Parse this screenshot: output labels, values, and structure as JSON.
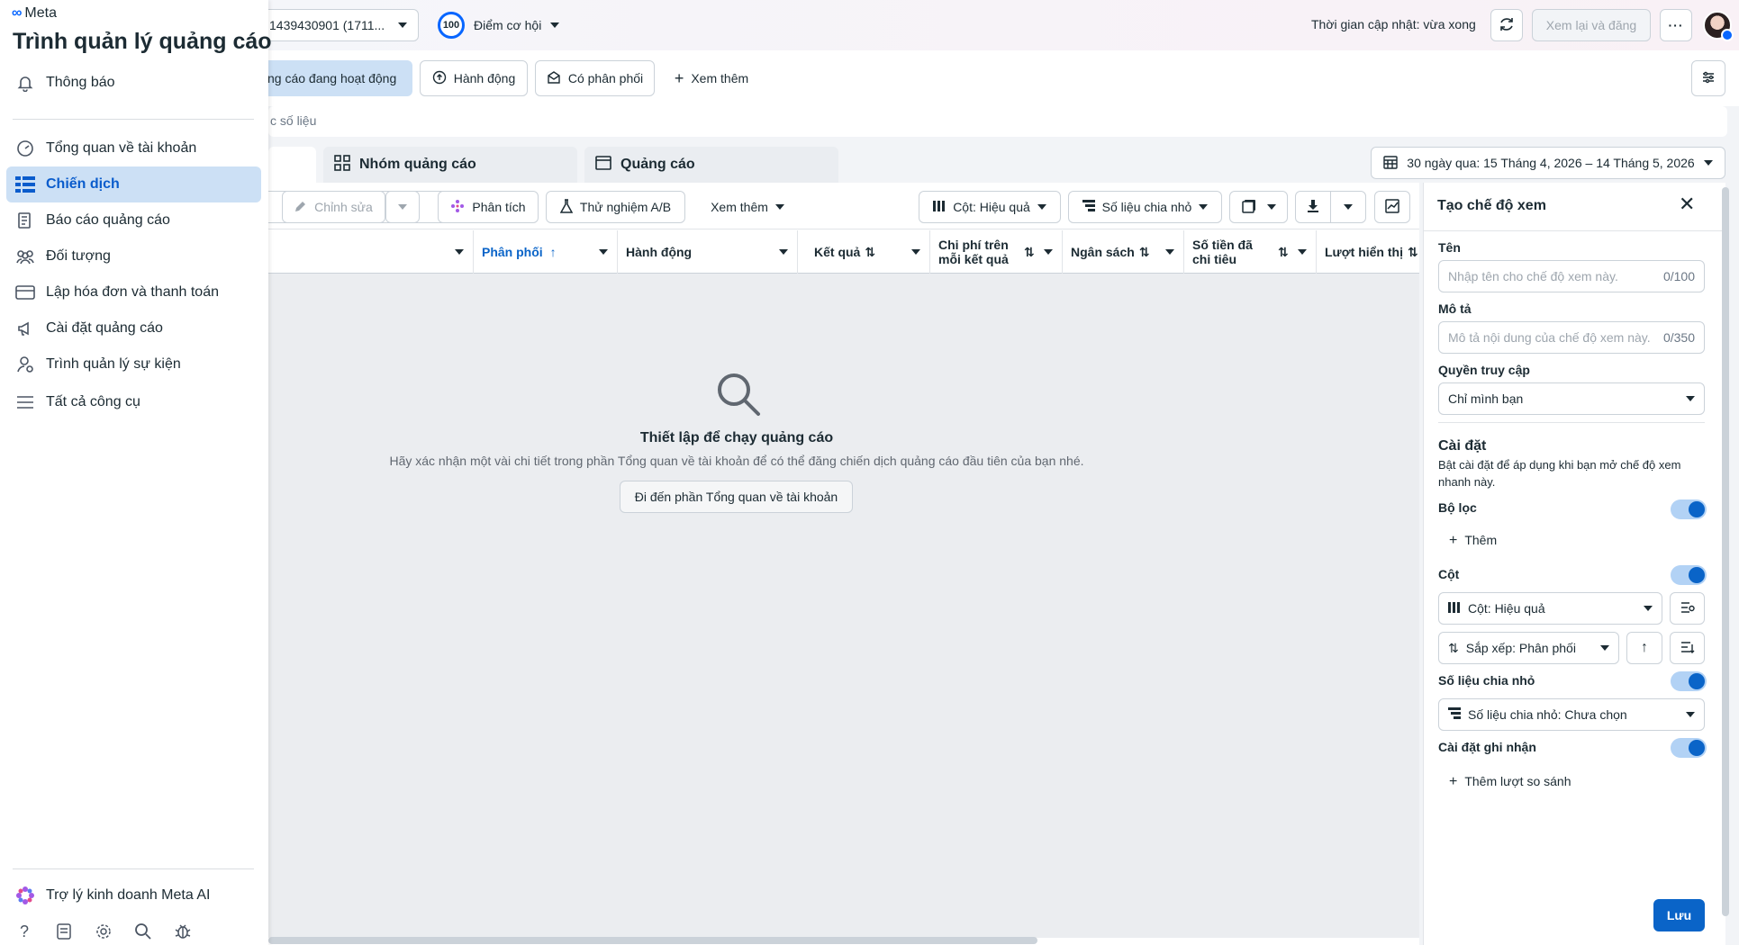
{
  "brand": {
    "logo_text": "Meta",
    "app_title": "Trình quản lý quảng cáo"
  },
  "sidebar": {
    "notifications": "Thông báo",
    "items": [
      {
        "label": "Tổng quan về tài khoản",
        "icon": "gauge-icon"
      },
      {
        "label": "Chiến dịch",
        "icon": "grid-table-icon"
      },
      {
        "label": "Báo cáo quảng cáo",
        "icon": "report-icon"
      },
      {
        "label": "Đối tượng",
        "icon": "people-icon"
      },
      {
        "label": "Lập hóa đơn và thanh toán",
        "icon": "credit-card-icon"
      },
      {
        "label": "Cài đặt quảng cáo",
        "icon": "megaphone-icon"
      },
      {
        "label": "Trình quản lý sự kiện",
        "icon": "events-icon"
      },
      {
        "label": "Tất cả công cụ",
        "icon": "menu-icon"
      }
    ],
    "meta_ai": "Trợ lý kinh doanh Meta AI"
  },
  "header": {
    "account": "1439430901 (1711...",
    "score": "100",
    "opportunity": "Điểm cơ hội",
    "update_time": "Thời gian cập nhật: vừa xong",
    "review_publish": "Xem lại và đăng"
  },
  "filters": {
    "active_ads": "ng cáo đang hoạt động",
    "actions": "Hành động",
    "delivery": "Có phân phối",
    "more": "Xem thêm",
    "search_placeholder": "c số liệu"
  },
  "tabs": {
    "adsets": "Nhóm quảng cáo",
    "ads": "Quảng cáo",
    "date_range": "30 ngày qua: 15 Tháng 4, 2026 – 14 Tháng 5, 2026"
  },
  "toolbar": {
    "edit": "Chỉnh sửa",
    "analyze": "Phân tích",
    "ab_test": "Thử nghiệm A/B",
    "more": "Xem thêm",
    "columns": "Cột: Hiệu quả",
    "breakdown": "Số liệu chia nhỏ"
  },
  "table": {
    "columns": [
      "Phân phối",
      "Hành động",
      "Kết quả",
      "Chi phí trên mỗi kết quả",
      "Ngân sách",
      "Số tiền đã chi tiêu",
      "Lượt hiển thị"
    ]
  },
  "empty_state": {
    "title": "Thiết lập để chạy quảng cáo",
    "description": "Hãy xác nhận một vài chi tiết trong phần Tổng quan về tài khoản để có thể đăng chiến dịch quảng cáo đầu tiên của bạn nhé.",
    "button": "Đi đến phần Tổng quan về tài khoản"
  },
  "panel": {
    "title": "Tạo chế độ xem",
    "name_label": "Tên",
    "name_placeholder": "Nhập tên cho chế độ xem này.",
    "name_counter": "0/100",
    "desc_label": "Mô tả",
    "desc_placeholder": "Mô tả nội dung của chế độ xem này.",
    "desc_counter": "0/350",
    "access_label": "Quyền truy cập",
    "access_value": "Chỉ mình bạn",
    "settings_title": "Cài đặt",
    "settings_desc": "Bật cài đặt để áp dụng khi bạn mở chế độ xem nhanh này.",
    "filters_label": "Bộ lọc",
    "add": "Thêm",
    "columns_label": "Cột",
    "columns_value": "Cột: Hiệu quả",
    "sort_value": "Sắp xếp: Phân phối",
    "breakdown_label": "Số liệu chia nhỏ",
    "breakdown_value": "Số liệu chia nhỏ: Chưa chọn",
    "attribution_label": "Cài đặt ghi nhận",
    "add_compare": "Thêm lượt so sánh",
    "save": "Lưu"
  },
  "colors": {
    "accent": "#0a64c8",
    "active_bg": "#cce0f5",
    "primary_blue": "#0866ff"
  }
}
